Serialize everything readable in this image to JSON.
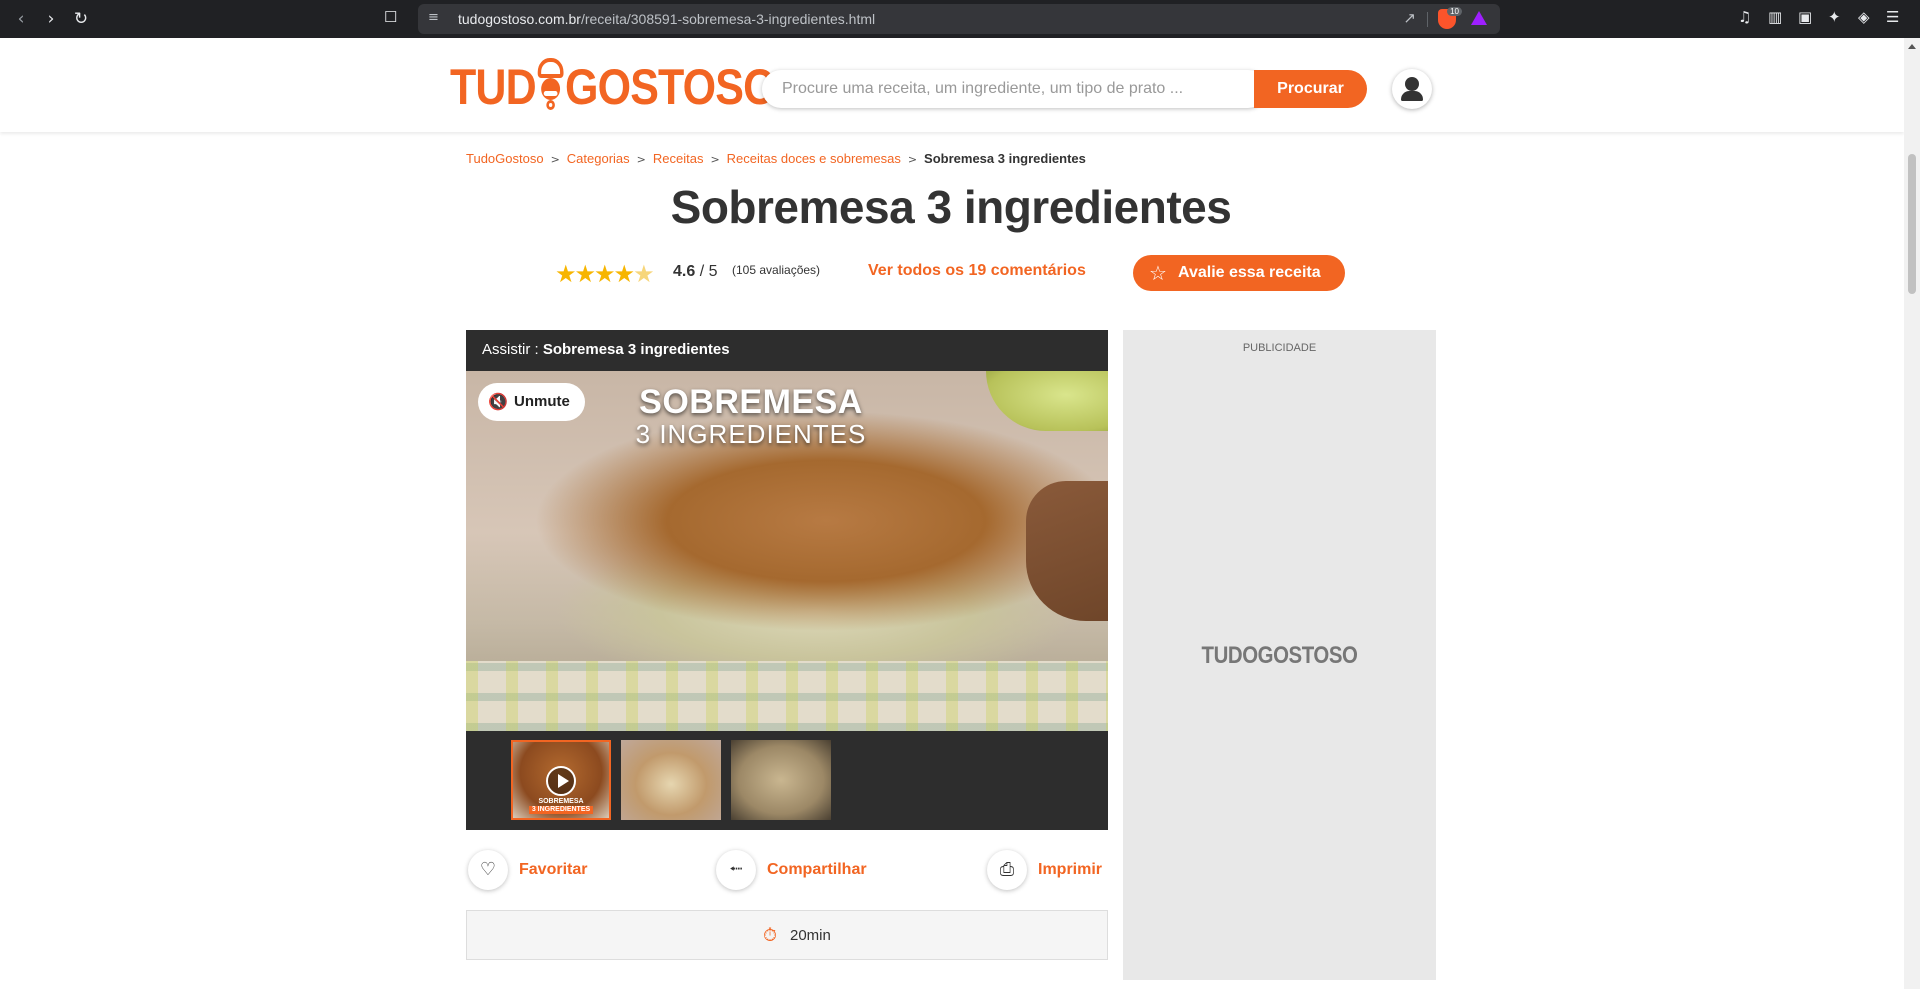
{
  "browser": {
    "url_host": "tudogostoso.com.br",
    "url_path": "/receita/308591-sobremesa-3-ingredientes.html",
    "brave_badge": "10",
    "nav_icons": [
      "back-icon",
      "forward-icon",
      "reload-icon",
      "bookmark-icon"
    ],
    "toolbar_icons": [
      "music-icon",
      "sidebar-icon",
      "wallet-icon",
      "leo-icon",
      "vpn-icon",
      "menu-icon"
    ]
  },
  "header": {
    "logo_left": "TUD",
    "logo_right": "GOSTOSO",
    "search_placeholder": "Procure uma receita, um ingrediente, um tipo de prato ...",
    "search_button": "Procurar"
  },
  "breadcrumb": {
    "items": [
      "TudoGostoso",
      "Categorias",
      "Receitas",
      "Receitas doces e sobremesas"
    ],
    "current": "Sobremesa 3 ingredientes",
    "separator": ">"
  },
  "recipe": {
    "title": "Sobremesa 3 ingredientes",
    "rating_value": "4.6",
    "rating_max": "/ 5",
    "rating_stars": 4.6,
    "rating_count": "(105 avaliações)",
    "comments_link": "Ver todos os 19 comentários",
    "rate_button": "Avalie essa receita"
  },
  "video": {
    "watch_prefix": "Assistir :",
    "watch_title": "Sobremesa 3 ingredientes",
    "overlay_line1": "SOBREMESA",
    "overlay_line2": "3 INGREDIENTES",
    "unmute_label": "Unmute",
    "thumb_caption_1": "SOBREMESA",
    "thumb_caption_2": "3 INGREDIENTES"
  },
  "actions": {
    "favorite": "Favoritar",
    "share": "Compartilhar",
    "print": "Imprimir"
  },
  "time": {
    "value": "20min"
  },
  "ad": {
    "label": "PUBLICIDADE",
    "logo": "TUDOGOSTOSO"
  },
  "colors": {
    "accent": "#f26522",
    "star": "#f7b500"
  }
}
